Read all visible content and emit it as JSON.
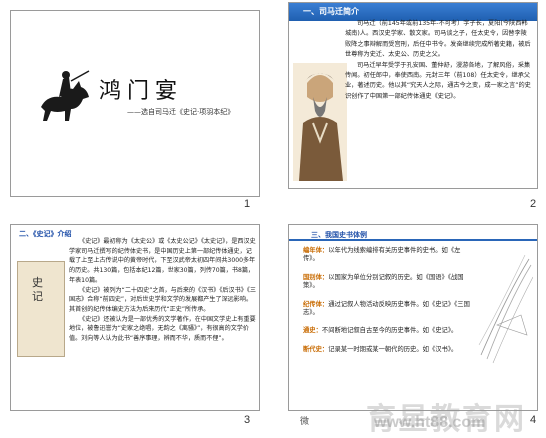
{
  "slide1": {
    "title": "鸿门宴",
    "subtitle": "——选自司马迁《史记·项羽本纪》",
    "number": "1"
  },
  "slide2": {
    "header": "一、司马迁简介",
    "para1": "司马迁（前145年或前135年-不可考）字子长，夏阳(今陕西韩城南)人。西汉史学家、散文家。司马谈之子，任太史令，因替李陵败降之事辩解而受宫刑，后任中书令。发奋继续完成所著史籍，被后世尊称为史迁、太史公、历史之父。",
    "para2": "司马迁早年受学于孔安国、董仲舒，漫游各地，了解风俗，采集传闻。初任郎中，奉使西南。元封三年（前108）任太史令，继承父业，著述历史。他以其“究天人之际，通古今之变，成一家之言”的史识创作了中国第一部纪传体通史《史记》。",
    "number": "2"
  },
  "slide3": {
    "header": "二、《史记》介绍",
    "book_title": "史记",
    "para1": "《史记》最初称为《太史公》或《太史公记》《太史记》，是西汉史学家司马迁撰写的纪传体史书，是中国历史上第一部纪传体通史，记载了上至上古传说中的黄帝时代，下至汉武帝太初四年间共3000多年的历史。共130篇，包括本纪12篇，世家30篇，列传70篇，书8篇，年表10篇。",
    "para2": "《史记》被列为“二十四史”之首，与后来的《汉书》《后汉书》《三国志》合称“前四史”，对后世史学和文学的发展都产生了深远影响。其首创的纪传体编史方法为后来历代“正史”所传承。",
    "para3": "《史记》还被认为是一部优秀的文学著作，在中国文学史上有重要地位，被鲁迅誉为“史家之绝唱，无韵之《离骚》”，有很高的文学价值。刘向等人认为此书“善序事理，辨而不华，质而不俚”。",
    "number": "3"
  },
  "slide4": {
    "header": "三、我国史书体例",
    "items": [
      {
        "key": "编年体：",
        "text": "以年代为线索编排有关历史事件的史书。如《左传》。"
      },
      {
        "key": "国别体：",
        "text": "以国家为单位分别记叙的历史。如《国语》《战国策》。"
      },
      {
        "key": "纪传体：",
        "text": "通过记叙人物活动反映历史事件。如《史记》《三国志》。"
      },
      {
        "key": "通史：",
        "text": "不间断地记叙自古至今的历史事件。如《史记》。"
      },
      {
        "key": "断代史：",
        "text": "记录某一时期或某一朝代的历史。如《汉书》。"
      }
    ],
    "number": "4"
  },
  "watermark": {
    "main": "育星教育网",
    "url": "www.ht88.com",
    "footer": "微"
  }
}
